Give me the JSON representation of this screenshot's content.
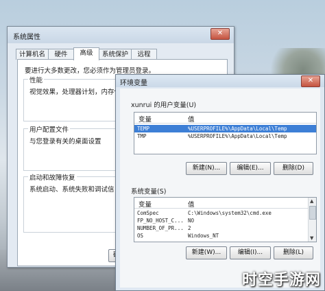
{
  "system_properties": {
    "title": "系统属性",
    "close": "✕",
    "tabs": [
      "计算机名",
      "硬件",
      "高级",
      "系统保护",
      "远程"
    ],
    "admin_note": "要进行大多数更改，您必须作为管理员登录。",
    "performance": {
      "label": "性能",
      "desc": "视觉效果，处理器计划，内存使"
    },
    "user_profiles": {
      "label": "用户配置文件",
      "desc": "与您登录有关的桌面设置"
    },
    "startup": {
      "label": "启动和故障恢复",
      "desc": "系统启动、系统失败和调试信"
    },
    "ok_button_partial": "确"
  },
  "env_vars": {
    "title": "环境变量",
    "close": "✕",
    "user_section_label": "xunrui 的用户变量(U)",
    "col_var": "变量",
    "col_val": "值",
    "user_vars": [
      {
        "name": "TEMP",
        "value": "%USERPROFILE%\\AppData\\Local\\Temp",
        "selected": true
      },
      {
        "name": "TMP",
        "value": "%USERPROFILE%\\AppData\\Local\\Temp",
        "selected": false
      }
    ],
    "user_buttons": {
      "new": "新建(N)...",
      "edit": "编辑(E)...",
      "delete": "删除(D)"
    },
    "system_section_label": "系统变量(S)",
    "system_vars": [
      {
        "name": "ComSpec",
        "value": "C:\\Windows\\system32\\cmd.exe"
      },
      {
        "name": "FP_NO_HOST_C...",
        "value": "NO"
      },
      {
        "name": "NUMBER_OF_PR...",
        "value": "2"
      },
      {
        "name": "OS",
        "value": "Windows_NT"
      }
    ],
    "system_buttons": {
      "new": "新建(W)...",
      "edit": "编辑(I)...",
      "delete": "删除(L)"
    }
  },
  "watermark": "时空手游网"
}
